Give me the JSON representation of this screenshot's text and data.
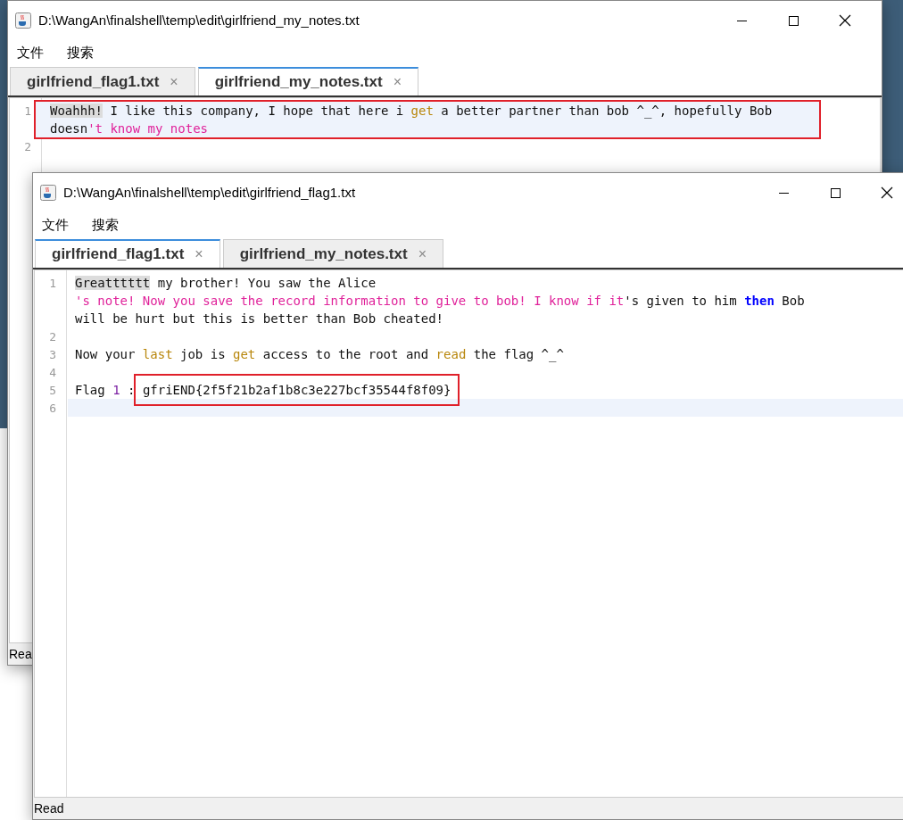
{
  "windows": [
    {
      "title": "D:\\WangAn\\finalshell\\temp\\edit\\girlfriend_my_notes.txt",
      "menu": [
        "文件",
        "搜索"
      ],
      "tabs": [
        {
          "label": "girlfriend_flag1.txt",
          "close": "×",
          "selected": false
        },
        {
          "label": "girlfriend_my_notes.txt",
          "close": "×",
          "selected": true
        }
      ],
      "lines": [
        {
          "number": "1",
          "current": true,
          "boxed": true,
          "rows": [
            {
              "spans": [
                {
                  "kind": "match",
                  "text": "Woahhh!"
                },
                {
                  "kind": "plain",
                  "text": " I like this company, I hope that here i "
                },
                {
                  "kind": "ident",
                  "text": "get"
                },
                {
                  "kind": "plain",
                  "text": " a better partner than bob ^_^, hopefully Bob"
                }
              ]
            },
            {
              "spans": [
                {
                  "kind": "plain",
                  "text": "doesn"
                },
                {
                  "kind": "string",
                  "text": "'t know my notes"
                }
              ]
            }
          ]
        },
        {
          "number": "2",
          "current": false,
          "boxed": false,
          "rows": [
            {
              "spans": []
            }
          ]
        }
      ],
      "status": "Rea"
    },
    {
      "title": "D:\\WangAn\\finalshell\\temp\\edit\\girlfriend_flag1.txt",
      "menu": [
        "文件",
        "搜索"
      ],
      "tabs": [
        {
          "label": "girlfriend_flag1.txt",
          "close": "×",
          "selected": true
        },
        {
          "label": "girlfriend_my_notes.txt",
          "close": "×",
          "selected": false
        }
      ],
      "lines": [
        {
          "number": "1",
          "current": false,
          "boxed": false,
          "rows": [
            {
              "spans": [
                {
                  "kind": "match",
                  "text": "Greatttttt"
                },
                {
                  "kind": "plain",
                  "text": " my brother! You saw the Alice"
                }
              ]
            },
            {
              "spans": [
                {
                  "kind": "string",
                  "text": "'s note! Now you save the record information to give to bob! I know if it"
                },
                {
                  "kind": "plain",
                  "text": "'s given to him "
                },
                {
                  "kind": "keyword",
                  "text": "then"
                },
                {
                  "kind": "plain",
                  "text": " Bob"
                }
              ]
            },
            {
              "spans": [
                {
                  "kind": "plain",
                  "text": "will be hurt but this is better than Bob cheated!"
                }
              ]
            }
          ]
        },
        {
          "number": "2",
          "current": false,
          "boxed": false,
          "rows": [
            {
              "spans": []
            }
          ]
        },
        {
          "number": "3",
          "current": false,
          "boxed": false,
          "rows": [
            {
              "spans": [
                {
                  "kind": "plain",
                  "text": "Now your "
                },
                {
                  "kind": "ident",
                  "text": "last"
                },
                {
                  "kind": "plain",
                  "text": " job is "
                },
                {
                  "kind": "ident",
                  "text": "get"
                },
                {
                  "kind": "plain",
                  "text": " access to the root and "
                },
                {
                  "kind": "ident",
                  "text": "read"
                },
                {
                  "kind": "plain",
                  "text": " the flag ^_^"
                }
              ]
            }
          ]
        },
        {
          "number": "4",
          "current": false,
          "boxed": false,
          "rows": [
            {
              "spans": []
            }
          ]
        },
        {
          "number": "5",
          "current": false,
          "boxed": false,
          "rows": [
            {
              "spans": [
                {
                  "kind": "plain",
                  "text": "Flag "
                },
                {
                  "kind": "number",
                  "text": "1"
                },
                {
                  "kind": "plain",
                  "text": " : "
                },
                {
                  "kind": "boxed",
                  "text": "gfriEND{2f5f21b2af1b8c3e227bcf35544f8f09}"
                }
              ]
            }
          ]
        },
        {
          "number": "6",
          "current": true,
          "boxed": false,
          "rows": [
            {
              "spans": []
            }
          ]
        }
      ],
      "status": "Read"
    }
  ]
}
